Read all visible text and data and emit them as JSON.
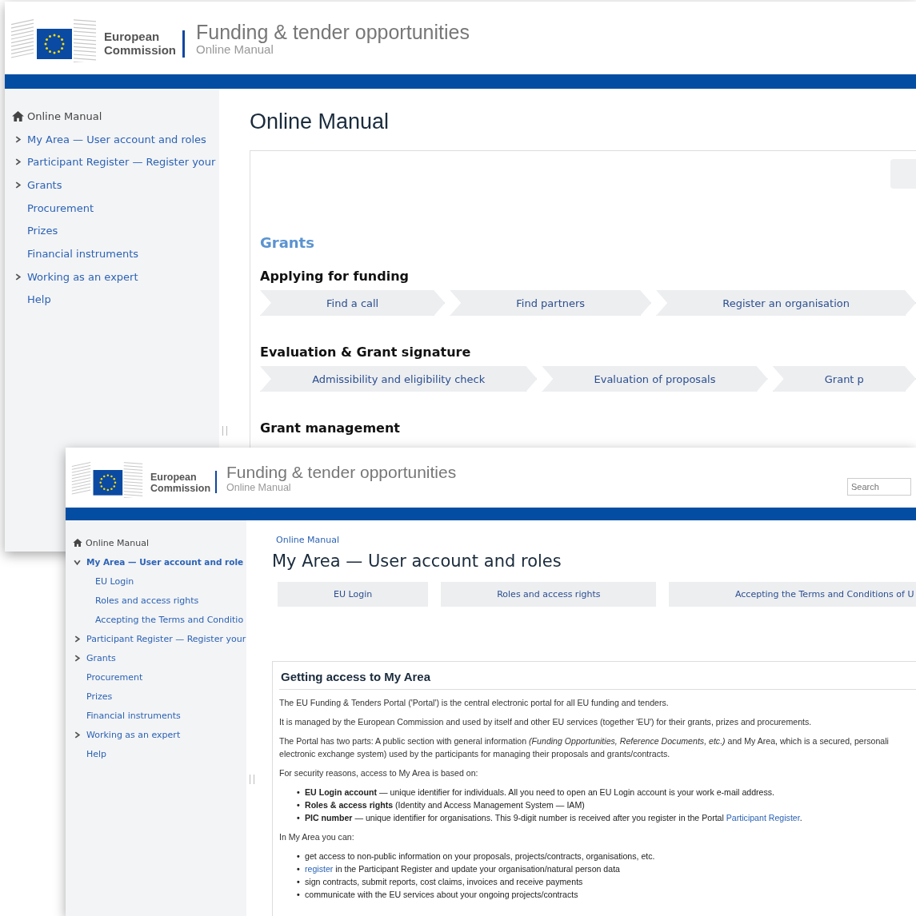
{
  "windows": [
    {
      "header": {
        "org_line_1": "European",
        "org_line_2": "Commission",
        "title": "Funding & tender opportunities",
        "subtitle": "Online Manual"
      },
      "sidebar": {
        "home": "Online Manual",
        "items": [
          {
            "label": "My Area — User account and roles",
            "kind": "group",
            "expanded": false,
            "selected": false
          },
          {
            "label": "Participant Register — Register your",
            "kind": "group",
            "expanded": false,
            "selected": false
          },
          {
            "label": "Grants",
            "kind": "group",
            "expanded": false,
            "selected": false
          },
          {
            "label": "Procurement",
            "kind": "link",
            "selected": false
          },
          {
            "label": "Prizes",
            "kind": "link",
            "selected": false
          },
          {
            "label": "Financial instruments",
            "kind": "link",
            "selected": false
          },
          {
            "label": "Working as an expert",
            "kind": "group",
            "expanded": false,
            "selected": false
          },
          {
            "label": "Help",
            "kind": "link",
            "selected": false
          }
        ]
      },
      "main": {
        "title": "Online Manual",
        "section_title": "Grants",
        "groups": [
          {
            "heading": "Applying for funding",
            "steps": [
              "Find a call",
              "Find partners",
              "Register an organisation"
            ]
          },
          {
            "heading": "Evaluation & Grant signature",
            "steps": [
              "Admissibility and eligibility check",
              "Evaluation of proposals",
              "Grant p"
            ]
          },
          {
            "heading": "Grant management"
          }
        ]
      }
    },
    {
      "header": {
        "org_line_1": "European",
        "org_line_2": "Commission",
        "title": "Funding & tender opportunities",
        "subtitle": "Online Manual",
        "search_placeholder": "Search"
      },
      "sidebar": {
        "home": "Online Manual",
        "items": [
          {
            "label": "My Area — User account and role",
            "kind": "group",
            "expanded": true,
            "selected": true,
            "children": [
              {
                "label": "EU Login",
                "selected": false
              },
              {
                "label": "Roles and access rights",
                "selected": false
              },
              {
                "label": "Accepting the Terms and Conditio",
                "selected": false
              }
            ]
          },
          {
            "label": "Participant Register — Register your",
            "kind": "group",
            "expanded": false,
            "selected": false
          },
          {
            "label": "Grants",
            "kind": "group",
            "expanded": false,
            "selected": false
          },
          {
            "label": "Procurement",
            "kind": "link",
            "selected": false
          },
          {
            "label": "Prizes",
            "kind": "link",
            "selected": false
          },
          {
            "label": "Financial instruments",
            "kind": "link",
            "selected": false
          },
          {
            "label": "Working as an expert",
            "kind": "group",
            "expanded": false,
            "selected": false
          },
          {
            "label": "Help",
            "kind": "link",
            "selected": false
          }
        ]
      },
      "main": {
        "breadcrumb": "Online Manual",
        "title": "My Area — User account and roles",
        "tabs": [
          "EU Login",
          "Roles and access rights",
          "Accepting the Terms and Conditions of U"
        ],
        "article": {
          "heading": "Getting access to My Area",
          "blocks": [
            {
              "kind": "para",
              "lines": [
                "The EU Funding & Tenders Portal ('Portal') is the central electronic portal for all EU funding and tenders."
              ]
            },
            {
              "kind": "para",
              "lines": [
                "It is managed by the European Commission and used by itself and other EU services (together 'EU') for their grants, prizes and procurements."
              ]
            },
            {
              "kind": "para",
              "lines": [
                "The Portal has two parts: A public section with general information *(Funding Opportunities, Reference Documents, etc.)* and My Area, which is a secured, personali",
                "electronic exchange system) used by the participants for managing their proposals and grants/contracts."
              ]
            },
            {
              "kind": "para",
              "lines": [
                "For security reasons, access to My Area is based on:"
              ]
            },
            {
              "kind": "list",
              "bullet": "•",
              "items": [
                {
                  "text": "**EU Login account** — unique identifier for individuals. All you need to open an EU Login account is your work e-mail address."
                },
                {
                  "text": "**Roles & access rights** (Identity and Access Management System — IAM)"
                },
                {
                  "text": "**PIC number** — unique identifier for organisations. This 9-digit number is received after you register in the Portal ",
                  "link": "Participant Register",
                  "after": "."
                }
              ]
            },
            {
              "kind": "para",
              "lines": [
                "In My Area you can:"
              ]
            },
            {
              "kind": "list",
              "bullet": "•",
              "items": [
                {
                  "text": "get access to non-public information on your proposals, projects/contracts, organisations, etc."
                },
                {
                  "before_link": "register",
                  "text": " in the Participant Register and update your organisation/natural person data"
                },
                {
                  "text": "sign contracts, submit reports, cost claims, invoices and receive payments"
                },
                {
                  "text": "communicate with the EU services about your ongoing projects/contracts"
                }
              ]
            }
          ]
        }
      }
    }
  ]
}
